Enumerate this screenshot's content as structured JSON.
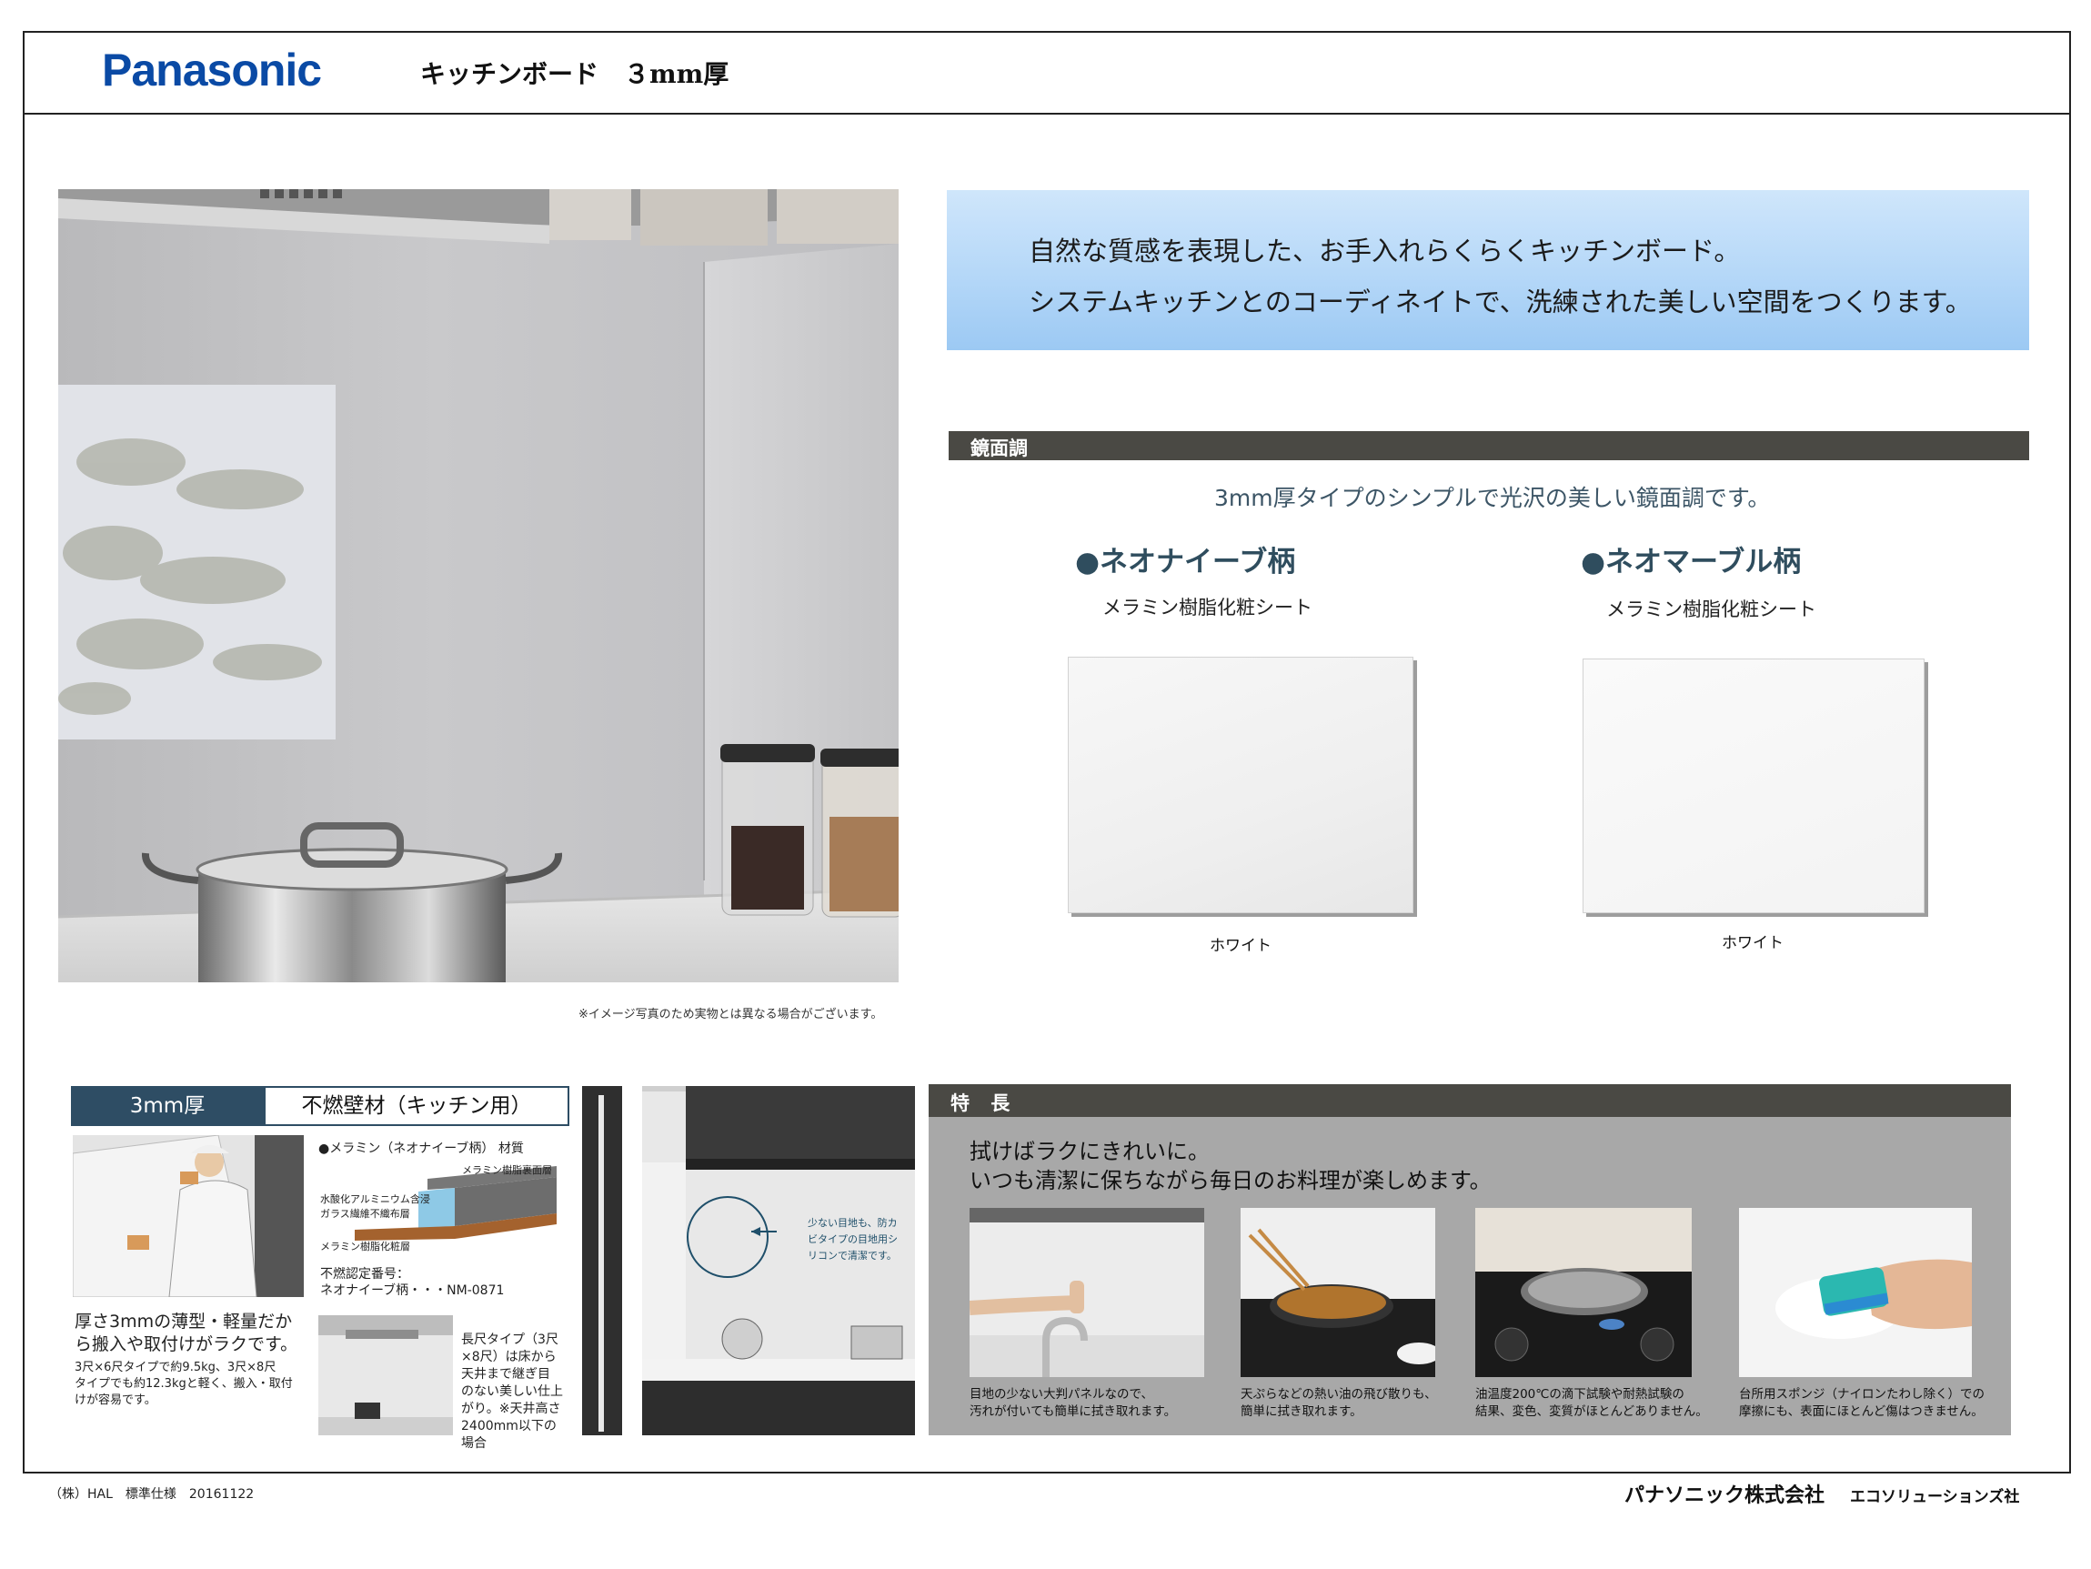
{
  "header": {
    "logo_text": "Panasonic",
    "title": "キッチンボード　３mm厚",
    "logo_color": "#0a4aa5"
  },
  "photo_note": "※イメージ写真のため実物とは異なる場合がございます。",
  "intro": {
    "line1": "自然な質感を表現した、お手入れらくらくキッチンボード。",
    "line2": "システムキッチンとのコーディネイトで、洗練された美しい空間をつくります。"
  },
  "mirror": {
    "heading": "鏡面調",
    "description": "3mm厚タイプのシンプルで光沢の美しい鏡面調です。",
    "products": [
      {
        "name": "●ネオナイーブ柄",
        "material": "メラミン樹脂化粧シート",
        "color": "ホワイト"
      },
      {
        "name": "●ネオマーブル柄",
        "material": "メラミン樹脂化粧シート",
        "color": "ホワイト"
      }
    ]
  },
  "spec": {
    "thickness_tag": "3mm厚",
    "fire_tag": "不燃壁材（キッチン用）",
    "material_heading": "●メラミン（ネオナイーブ柄） 材質",
    "layer_back": "メラミン樹脂裏面層",
    "layer_core_1": "水酸化アルミニウム含浸",
    "layer_core_2": "ガラス繊維不織布層",
    "layer_face": "メラミン樹脂化粧層",
    "cert_label": "不燃認定番号：",
    "cert_value": "ネオナイーブ柄・・・NM-0871",
    "light_lead_1": "厚さ3mmの薄型・軽量だか",
    "light_lead_2": "ら搬入や取付けがラクです。",
    "light_body_1": "3尺×6尺タイプで約9.5kg、3尺×8尺",
    "light_body_2": "タイプでも約12.3kgと軽く、搬入・取付",
    "light_body_3": "けが容易です。",
    "long_1": "長尺タイプ（3尺",
    "long_2": "×8尺）は床から",
    "long_3": "天井まで継ぎ目",
    "long_4": "のない美しい仕上",
    "long_5": "がり。※天井高さ",
    "long_6": "2400mm以下の",
    "long_7": "場合",
    "joint_1": "少ない目地も、防カ",
    "joint_2": "ビタイプの目地用シ",
    "joint_3": "リコンで清潔です。"
  },
  "features": {
    "heading": "特 長",
    "lead1": "拭けばラクにきれいに。",
    "lead2": "いつも清潔に保ちながら毎日のお料理が楽しめます。",
    "items": [
      {
        "cap1": "目地の少ない大判パネルなので、",
        "cap2": "汚れが付いても簡単に拭き取れます。"
      },
      {
        "cap1": "天ぷらなどの熱い油の飛び散りも、",
        "cap2": "簡単に拭き取れます。"
      },
      {
        "cap1": "油温度200℃の滴下試験や耐熱試験の",
        "cap2": "結果、変色、変質がほとんどありません。"
      },
      {
        "cap1": "台所用スポンジ（ナイロンたわし除く）での",
        "cap2": "摩擦にも、表面にほとんど傷はつきません。"
      }
    ]
  },
  "footer": {
    "left": "（株）HAL　標準仕様　20161122",
    "company": "パナソニック株式会社",
    "division": "エコソリューションズ社"
  }
}
